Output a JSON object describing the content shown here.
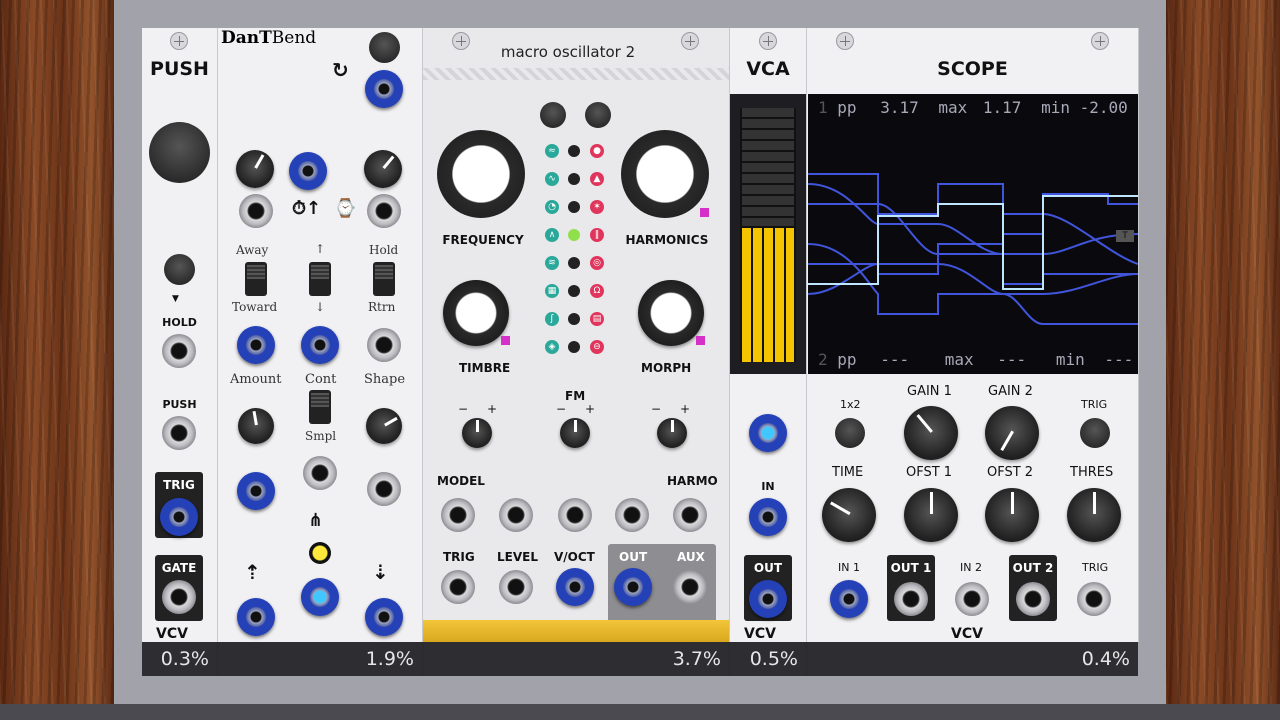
{
  "modules": {
    "push": {
      "title": "PUSH",
      "hold_label": "HOLD",
      "push_label": "PUSH",
      "trig_label": "TRIG",
      "gate_label": "GATE"
    },
    "bend": {
      "brand": "DanT",
      "name": "Bend",
      "away": "Away",
      "toward": "Toward",
      "up_arrow": "↑",
      "down_arrow": "↓",
      "hold": "Hold",
      "rtrn": "Rtrn",
      "amount": "Amount",
      "cont": "Cont",
      "shape": "Shape",
      "smpl": "Smpl"
    },
    "macro": {
      "title": "macro oscillator 2",
      "frequency": "FREQUENCY",
      "harmonics": "HARMONICS",
      "timbre": "TIMBRE",
      "morph": "MORPH",
      "fm": "FM",
      "model": "MODEL",
      "harmo": "HARMO",
      "trig": "TRIG",
      "level": "LEVEL",
      "voct": "V/OCT",
      "out": "OUT",
      "aux": "AUX",
      "minus": "−",
      "plus": "+"
    },
    "vca": {
      "title": "VCA",
      "in_label": "IN",
      "out_label": "OUT"
    },
    "scope": {
      "title": "SCOPE",
      "ch1_line": {
        "idx": "1",
        "pp": "pp",
        "pp_val": "3.17",
        "max": "max",
        "max_val": "1.17",
        "min": "min",
        "min_val": "-2.00"
      },
      "ch2_line": {
        "idx": "2",
        "pp": "pp",
        "pp_val": "---",
        "max": "max",
        "max_val": "---",
        "min": "min",
        "min_val": "---"
      },
      "x1x2": "1x2",
      "gain1": "GAIN 1",
      "gain2": "GAIN 2",
      "trig": "TRIG",
      "time": "TIME",
      "ofst1": "OFST 1",
      "ofst2": "OFST 2",
      "thres": "THRES",
      "in1": "IN 1",
      "out1": "OUT 1",
      "in2": "IN 2",
      "out2": "OUT 2",
      "trig2": "TRIG",
      "brand": "VCV"
    }
  },
  "cpu_meters": {
    "push": "0.3%",
    "bend": "1.9%",
    "macro": "3.7%",
    "vca": "0.5%",
    "scope": "0.4%"
  },
  "vca_brand": "VCV",
  "push_brand": "VCV",
  "colors": {
    "cable_blue": "#2441b8",
    "accent_magenta": "#d530c8",
    "meter_yellow": "#f5c400",
    "scope_trace": "#4a63ff"
  }
}
